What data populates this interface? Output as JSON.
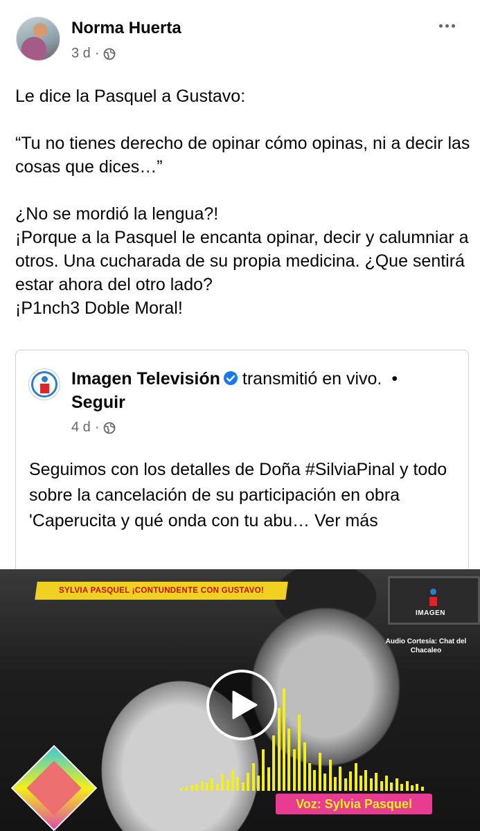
{
  "post": {
    "author": "Norma Huerta",
    "time": "3 d",
    "audience_icon": "globe-icon",
    "more_icon": "more-dots-icon",
    "text": {
      "line1": "Le dice la Pasquel a Gustavo:",
      "quote": "“Tu no tienes derecho de opinar cómo opinas, ni a decir las cosas que dices…”",
      "line3": "¿No se mordió la lengua?!",
      "line4": "¡Porque a la Pasquel le encanta opinar, decir y calumniar a otros. Una cucharada de su propia medicina. ¿Que sentirá estar ahora del otro lado?",
      "line5": "¡P1nch3 Doble Moral!"
    }
  },
  "shared": {
    "page_name": "Imagen Televisión",
    "verified_icon": "verified-badge-icon",
    "action": "transmitió en vivo.",
    "separator": "•",
    "follow_label": "Seguir",
    "time": "4 d",
    "text": "Seguimos con los detalles de Doña #SilviaPinal y todo sobre la cancelación de su participación en obra 'Caperucita y qué onda con tu abu…",
    "see_more": "Ver más"
  },
  "video": {
    "banner": "SYLVIA PASQUEL ¡CONTUNDENTE CON GUSTAVO!",
    "watermark": "IMAGEN",
    "audio_credit": "Audio Cortesía: Chat del Chacaleo",
    "voice_label": "Voz: Sylvia Pasquel",
    "play_icon": "play-icon",
    "colors": {
      "banner_bg": "#f0d020",
      "banner_text": "#c21010",
      "voice_bg": "#e83c92",
      "voice_text": "#f5f21f",
      "wave": "#f2ef1a"
    }
  }
}
